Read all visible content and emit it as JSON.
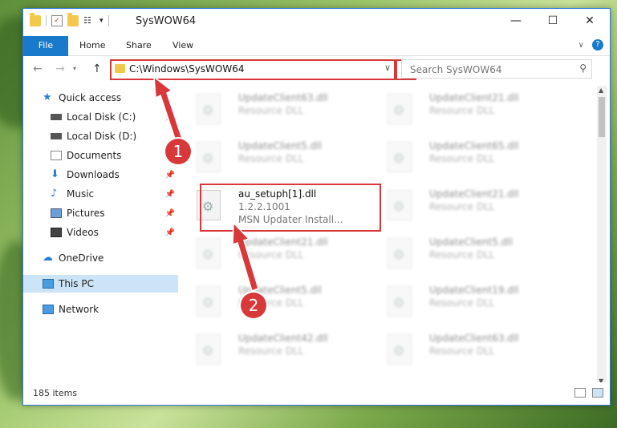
{
  "window": {
    "title": "SysWOW64",
    "controls": {
      "minimize": "—",
      "maximize": "☐",
      "close": "✕"
    }
  },
  "ribbon": {
    "tabs": [
      "File",
      "Home",
      "Share",
      "View"
    ]
  },
  "nav": {
    "back": "←",
    "forward": "→",
    "up": "↑",
    "address": "C:\\Windows\\SysWOW64",
    "refresh": "↻",
    "search_placeholder": "Search SysWOW64"
  },
  "sidebar": {
    "items": [
      {
        "label": "Quick access",
        "icon": "star-icon"
      },
      {
        "label": "Local Disk (C:)",
        "icon": "drive-icon"
      },
      {
        "label": "Local Disk (D:)",
        "icon": "drive-icon"
      },
      {
        "label": "Documents",
        "icon": "documents-icon"
      },
      {
        "label": "Downloads",
        "icon": "download-icon"
      },
      {
        "label": "Music",
        "icon": "music-icon"
      },
      {
        "label": "Pictures",
        "icon": "pictures-icon"
      },
      {
        "label": "Videos",
        "icon": "videos-icon"
      },
      {
        "label": "OneDrive",
        "icon": "cloud-icon"
      },
      {
        "label": "This PC",
        "icon": "computer-icon"
      },
      {
        "label": "Network",
        "icon": "network-icon"
      }
    ]
  },
  "files": {
    "left": [
      {
        "name": "UpdateClient63.dll",
        "type": "Resource DLL"
      },
      {
        "name": "UpdateClient5.dll",
        "type": "Resource DLL"
      },
      {
        "name": "au_setuph[1].dll",
        "version": "1.2.2.1001",
        "desc": "MSN Updater Install..."
      },
      {
        "name": "UpdateClient21.dll",
        "type": "Resource DLL"
      },
      {
        "name": "UpdateClient5.dll",
        "type": "Resource DLL"
      },
      {
        "name": "UpdateClient42.dll",
        "type": "Resource DLL"
      }
    ],
    "right": [
      {
        "name": "UpdateClient21.dll",
        "type": "Resource DLL"
      },
      {
        "name": "UpdateClient65.dll",
        "type": "Resource DLL"
      },
      {
        "name": "UpdateClient21.dll",
        "type": "Resource DLL"
      },
      {
        "name": "UpdateClient5.dll",
        "type": "Resource DLL"
      },
      {
        "name": "UpdateClient19.dll",
        "type": "Resource DLL"
      },
      {
        "name": "UpdateClient63.dll",
        "type": "Resource DLL"
      }
    ]
  },
  "status": {
    "item_count": "185 items"
  },
  "annotations": {
    "step1": "1",
    "step2": "2",
    "color": "#d9383a"
  }
}
